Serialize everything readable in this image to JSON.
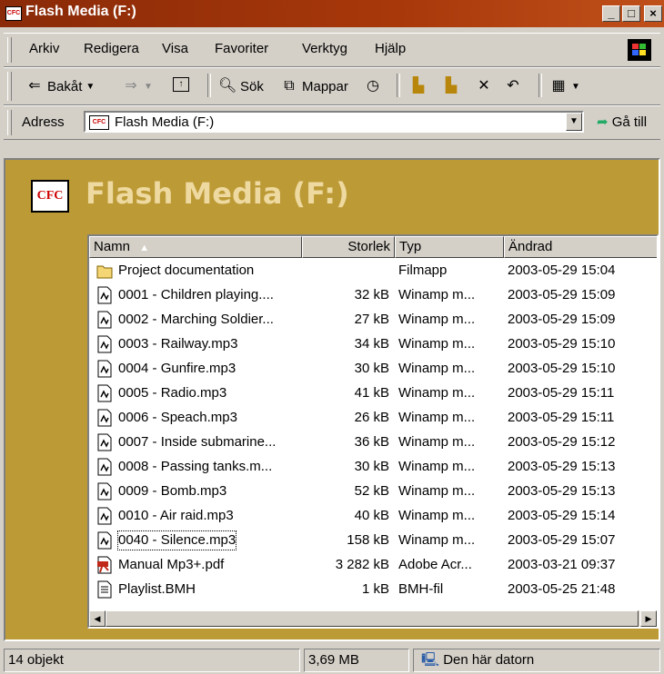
{
  "window": {
    "title": "Flash Media (F:)",
    "app_icon": "CFC",
    "minimize": "_",
    "maximize": "□",
    "close": "×"
  },
  "menu": [
    "Arkiv",
    "Redigera",
    "Visa",
    "Favoriter",
    "Verktyg",
    "Hjälp"
  ],
  "toolbar": {
    "back": "Bakåt",
    "search": "Sök",
    "folders": "Mappar"
  },
  "address": {
    "label": "Adress",
    "value": "Flash Media (F:)",
    "go": "Gå till"
  },
  "folder": {
    "title": "Flash Media (F:)",
    "icon": "CFC"
  },
  "columns": {
    "name": "Namn",
    "size": "Storlek",
    "type": "Typ",
    "modified": "Ändrad"
  },
  "files": [
    {
      "name": "Project documentation",
      "size": "",
      "type": "Filmapp",
      "modified": "2003-05-29 15:04",
      "icon": "folder-icon"
    },
    {
      "name": "0001 - Children playing....",
      "size": "32 kB",
      "type": "Winamp m...",
      "modified": "2003-05-29 15:09",
      "icon": "winamp-file-icon"
    },
    {
      "name": "0002 - Marching Soldier...",
      "size": "27 kB",
      "type": "Winamp m...",
      "modified": "2003-05-29 15:09",
      "icon": "winamp-file-icon"
    },
    {
      "name": "0003 - Railway.mp3",
      "size": "34 kB",
      "type": "Winamp m...",
      "modified": "2003-05-29 15:10",
      "icon": "winamp-file-icon"
    },
    {
      "name": "0004 - Gunfire.mp3",
      "size": "30 kB",
      "type": "Winamp m...",
      "modified": "2003-05-29 15:10",
      "icon": "winamp-file-icon"
    },
    {
      "name": "0005 - Radio.mp3",
      "size": "41 kB",
      "type": "Winamp m...",
      "modified": "2003-05-29 15:11",
      "icon": "winamp-file-icon"
    },
    {
      "name": "0006 - Speach.mp3",
      "size": "26 kB",
      "type": "Winamp m...",
      "modified": "2003-05-29 15:11",
      "icon": "winamp-file-icon"
    },
    {
      "name": "0007 - Inside submarine...",
      "size": "36 kB",
      "type": "Winamp m...",
      "modified": "2003-05-29 15:12",
      "icon": "winamp-file-icon"
    },
    {
      "name": "0008 - Passing tanks.m...",
      "size": "30 kB",
      "type": "Winamp m...",
      "modified": "2003-05-29 15:13",
      "icon": "winamp-file-icon"
    },
    {
      "name": "0009 - Bomb.mp3",
      "size": "52 kB",
      "type": "Winamp m...",
      "modified": "2003-05-29 15:13",
      "icon": "winamp-file-icon"
    },
    {
      "name": "0010 - Air raid.mp3",
      "size": "40 kB",
      "type": "Winamp m...",
      "modified": "2003-05-29 15:14",
      "icon": "winamp-file-icon"
    },
    {
      "name": "0040 - Silence.mp3",
      "size": "158 kB",
      "type": "Winamp m...",
      "modified": "2003-05-29 15:07",
      "icon": "winamp-file-icon"
    },
    {
      "name": "Manual Mp3+.pdf",
      "size": "3 282 kB",
      "type": "Adobe Acr...",
      "modified": "2003-03-21 09:37",
      "icon": "pdf-file-icon"
    },
    {
      "name": "Playlist.BMH",
      "size": "1 kB",
      "type": "BMH-fil",
      "modified": "2003-05-25 21:48",
      "icon": "text-file-icon"
    }
  ],
  "status": {
    "count": "14 objekt",
    "size": "3,69 MB",
    "location": "Den här datorn"
  },
  "colors": {
    "title_bar": "#a8380a",
    "content_bg": "#bc9a36",
    "folder_title": "#eed9a0"
  }
}
